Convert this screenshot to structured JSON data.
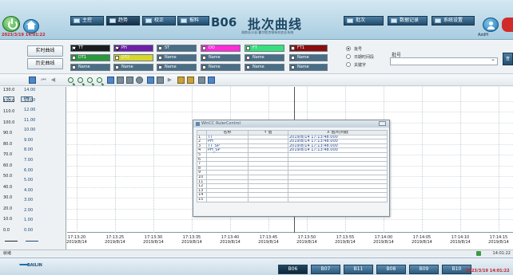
{
  "header": {
    "datetime": "2023/3/19 14:01:22",
    "nav": [
      {
        "label": "主控"
      },
      {
        "label": "趋势"
      },
      {
        "label": "校正"
      },
      {
        "label": "报料"
      }
    ],
    "code": "B06",
    "title": "批次曲线",
    "subtitle": "湖南长沙县·霍尔斯克顿有机农业系统",
    "right_nav": [
      {
        "label": "批次"
      },
      {
        "label": "数据记录"
      },
      {
        "label": "系统设置"
      }
    ],
    "user": "AzdH"
  },
  "filter": {
    "buttons": [
      "实时曲线",
      "历史曲线"
    ],
    "tags": [
      {
        "label": "TT",
        "color": "#1c1c1c",
        "checked": true
      },
      {
        "label": "PH",
        "color": "#6d1fa8",
        "checked": true
      },
      {
        "label": "ST",
        "color": "#4a6e86",
        "checked": false
      },
      {
        "label": "DO",
        "color": "#ff2bd6",
        "checked": false
      },
      {
        "label": "FT",
        "color": "#37e07a",
        "checked": false
      },
      {
        "label": "FT1",
        "color": "#8a0e0e",
        "checked": false
      },
      {
        "label": "DT1",
        "color": "#2a9a3a",
        "checked": false
      },
      {
        "label": "DT2",
        "color": "#d8d62a",
        "checked": false
      },
      {
        "label": "Name",
        "color": "#4a6e86",
        "checked": false
      },
      {
        "label": "Name",
        "color": "#4a6e86",
        "checked": false
      },
      {
        "label": "Name",
        "color": "#4a6e86",
        "checked": false
      },
      {
        "label": "Name",
        "color": "#4a6e86",
        "checked": false
      },
      {
        "label": "Name",
        "color": "#4a6e86",
        "checked": false
      },
      {
        "label": "Name",
        "color": "#4a6e86",
        "checked": false
      },
      {
        "label": "Name",
        "color": "#4a6e86",
        "checked": false
      },
      {
        "label": "Name",
        "color": "#4a6e86",
        "checked": false
      },
      {
        "label": "Name",
        "color": "#4a6e86",
        "checked": false
      },
      {
        "label": "Name",
        "color": "#4a6e86",
        "checked": false
      }
    ],
    "radios": [
      {
        "label": "批号",
        "on": true
      },
      {
        "label": "日期时间段",
        "on": false
      },
      {
        "label": "关键字",
        "on": false
      }
    ],
    "batch_label": "批号",
    "query_label": "查"
  },
  "chart": {
    "axis_units": [
      "℃",
      "PH"
    ],
    "y1_ticks": [
      "130.0",
      "120.0",
      "110.0",
      "100.0",
      "90.0",
      "80.0",
      "70.0",
      "60.0",
      "50.0",
      "40.0",
      "30.0",
      "20.0",
      "10.0",
      "0.0"
    ],
    "y2_ticks": [
      "14.00",
      "13.00",
      "12.00",
      "11.00",
      "10.00",
      "9.00",
      "8.00",
      "7.00",
      "6.00",
      "5.00",
      "4.00",
      "3.00",
      "2.00",
      "1.00",
      "0.00"
    ],
    "x_ticks": [
      {
        "time": "17:13:20",
        "date": "2019/8/14"
      },
      {
        "time": "17:13:25",
        "date": "2019/8/14"
      },
      {
        "time": "17:13:30",
        "date": "2019/8/14"
      },
      {
        "time": "17:13:35",
        "date": "2019/8/14"
      },
      {
        "time": "17:13:40",
        "date": "2019/8/14"
      },
      {
        "time": "17:13:45",
        "date": "2019/8/14"
      },
      {
        "time": "17:13:50",
        "date": "2019/8/14"
      },
      {
        "time": "17:13:55",
        "date": "2019/8/14"
      },
      {
        "time": "17:14:00",
        "date": "2019/8/14"
      },
      {
        "time": "17:14:05",
        "date": "2019/8/14"
      },
      {
        "time": "17:14:10",
        "date": "2019/8/14"
      },
      {
        "time": "17:14:15",
        "date": "2019/8/14"
      }
    ]
  },
  "dialog": {
    "title": "WinCC RulerControl",
    "headers": [
      "",
      "名称",
      "Y 值",
      "X 值/时间戳"
    ],
    "rows": [
      {
        "idx": "1",
        "name": "TT",
        "y": "",
        "x": "2019/8/14 17:13:48.000"
      },
      {
        "idx": "2",
        "name": "PH",
        "y": "",
        "x": "2019/8/14 17:13:48.000"
      },
      {
        "idx": "3",
        "name": "TT_SP",
        "y": "",
        "x": "2019/8/14 17:13:48.000"
      },
      {
        "idx": "4",
        "name": "PH_SP",
        "y": "",
        "x": "2019/8/14 17:13:48.000"
      },
      {
        "idx": "5",
        "name": "",
        "y": "",
        "x": ""
      },
      {
        "idx": "6",
        "name": "",
        "y": "",
        "x": ""
      },
      {
        "idx": "7",
        "name": "",
        "y": "",
        "x": ""
      },
      {
        "idx": "8",
        "name": "",
        "y": "",
        "x": ""
      },
      {
        "idx": "9",
        "name": "",
        "y": "",
        "x": ""
      },
      {
        "idx": "10",
        "name": "",
        "y": "",
        "x": ""
      },
      {
        "idx": "11",
        "name": "",
        "y": "",
        "x": ""
      },
      {
        "idx": "12",
        "name": "",
        "y": "",
        "x": ""
      },
      {
        "idx": "13",
        "name": "",
        "y": "",
        "x": ""
      },
      {
        "idx": "14",
        "name": "",
        "y": "",
        "x": ""
      },
      {
        "idx": "15",
        "name": "",
        "y": "",
        "x": ""
      }
    ]
  },
  "status": {
    "text": "就绪",
    "time": "14:01:22"
  },
  "footer": {
    "logo": "BAILIN",
    "tabs": [
      {
        "label": "B06",
        "active": true
      },
      {
        "label": "B07",
        "active": false
      },
      {
        "label": "B11",
        "active": false
      },
      {
        "label": "B08",
        "active": false
      },
      {
        "label": "B09",
        "active": false
      },
      {
        "label": "B10",
        "active": false
      }
    ],
    "datetime": "2023/3/19 14:01:22"
  }
}
